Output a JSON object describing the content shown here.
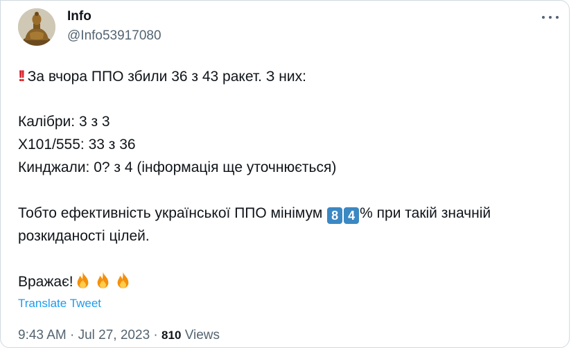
{
  "author": {
    "name": "Info",
    "handle": "@Info53917080"
  },
  "tweet": {
    "line1": "За вчора ППО збили 36 з 43 ракет. З них:",
    "line2": "Калібри: 3 з 3",
    "line3": "Х101/555: 33 з 36",
    "line4": "Кинджали: 0? з 4 (інформація ще уточнюється)",
    "line5_before": "Тобто ефективність української ППО мінімум ",
    "digit1": "8",
    "digit2": "4",
    "line5_after": "% при такій значній",
    "line6": "розкиданості цілей.",
    "line7": "Вражає!"
  },
  "translate_label": "Translate Tweet",
  "meta": {
    "time": "9:43 AM",
    "separator": "·",
    "date": "Jul 27, 2023",
    "views_count": "810",
    "views_label": "Views"
  },
  "colors": {
    "text": "#0f1419",
    "secondary": "#536471",
    "link": "#1d9bf0",
    "keycap": "#3b88c3",
    "border": "#cfd9de"
  },
  "icons": [
    "double-exclamation-icon",
    "fire-icon",
    "more-options-icon"
  ]
}
